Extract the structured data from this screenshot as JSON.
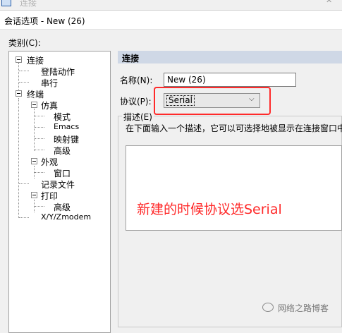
{
  "window": {
    "ghost_title": "连接",
    "close_glyph": "✕"
  },
  "dialog": {
    "title": "会话选项 - New (26)"
  },
  "category": {
    "label": "类别(C):"
  },
  "tree": {
    "connection": "连接",
    "logon_actions": "登陆动作",
    "serial": "串行",
    "terminal": "终端",
    "emulation": "仿真",
    "modes": "模式",
    "emacs": "Emacs",
    "mapped_keys": "映射键",
    "advanced": "高级",
    "appearance": "外观",
    "window": "窗口",
    "log_file": "记录文件",
    "printing": "打印",
    "print_advanced": "高级",
    "xyzmodem": "X/Y/Zmodem"
  },
  "panel": {
    "header": "连接",
    "name_label": "名称(N):",
    "name_value": "New (26)",
    "protocol_label": "协议(P):",
    "protocol_value": "Serial",
    "chevron": "⌵",
    "description_label": "描述(E)",
    "description_hint": "在下面输入一个描述，它可以可选择地被显示在连接窗口中"
  },
  "annotation": {
    "text": "新建的时候协议选Serial",
    "color": "#ff2a2a"
  },
  "watermark": {
    "text": "网络之路博客"
  }
}
